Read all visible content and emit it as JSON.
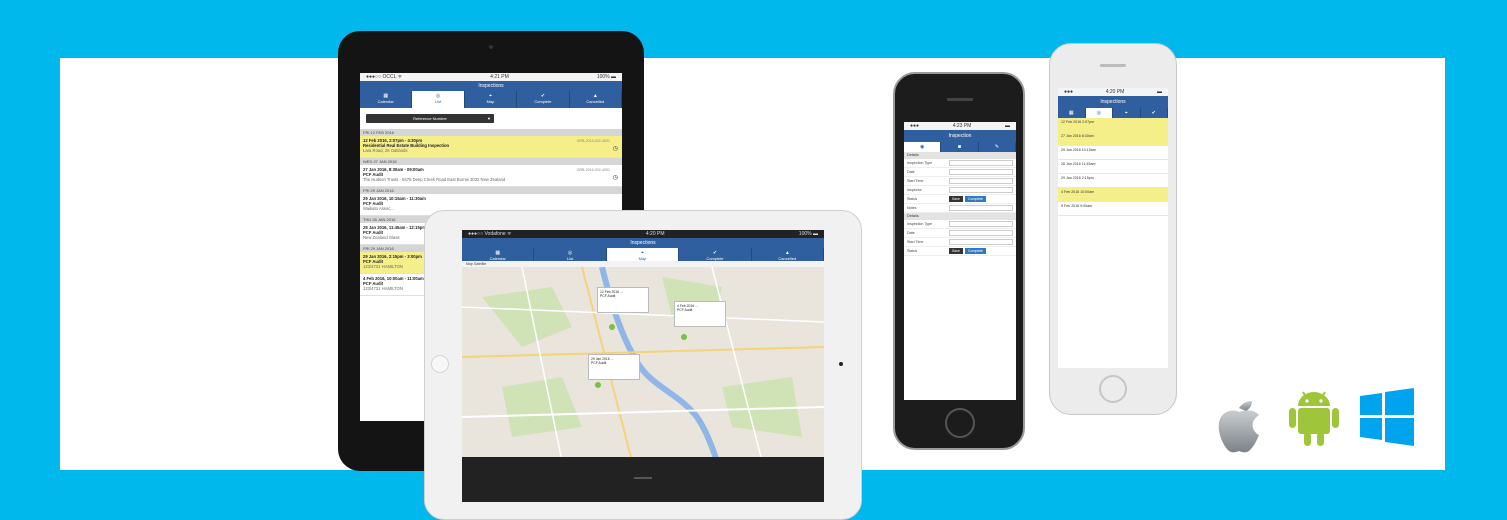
{
  "tablet_list": {
    "status_left": "●●●○○ OCCL ᯤ",
    "status_time": "4:21 PM",
    "status_right": "100% ▬",
    "title": "Inspections",
    "tabs": [
      "Calendar",
      "List",
      "Map",
      "Complete",
      "Cancelled"
    ],
    "filter_label": "Reference Number",
    "groups": [
      {
        "date": "FRI 12 FEB 2016",
        "time": "12 Feb 2016, 2:07pm - 4:30pm",
        "title": "Residential Real Estate Building Inspection",
        "addr": "Lara Road, 26 Oatlands",
        "ref": "ORB-2016-002-4001"
      },
      {
        "date": "WED 27 JAN 2016",
        "time": "27 Jan 2016, 8:30am - 09:00am",
        "title": "PCF Audit",
        "addr": "The Hudson Trusts - 5476 Deep Creek Road East Burnie 3032 New Zealand",
        "ref": "ORB-2016-002-4001"
      },
      {
        "date": "FRI 29 JAN 2016",
        "time": "29 Jan 2016, 10:15am - 11:30am",
        "title": "PCF Audit",
        "addr": "Waikato Assoc...",
        "ref": ""
      },
      {
        "date": "THU 28 JAN 2016",
        "time": "28 Jan 2016, 11:45am - 12:15pm",
        "title": "PCF Audit",
        "addr": "New Zealand Glass",
        "ref": ""
      },
      {
        "date": "FRI 29 JAN 2016",
        "time": "29 Jan 2016, 2:15pm - 3:00pm",
        "title": "PCF Audit",
        "addr": "123/4731 HAMILTON",
        "ref": ""
      },
      {
        "date": "",
        "time": "4 Feb 2016, 10:00am - 11:00am",
        "title": "PCF Audit",
        "addr": "123/4731 HAMILTON",
        "ref": ""
      }
    ]
  },
  "tablet_map": {
    "status_left": "●●●○○ Vodafone ᯤ",
    "status_time": "4:20 PM",
    "status_right": "100% ▬",
    "title": "Inspections",
    "tabs": [
      "Calendar",
      "List",
      "Map",
      "Complete",
      "Cancelled"
    ],
    "toolbar": "Map  Satellite",
    "popups": [
      {
        "title": "12 Feb 2016 ...",
        "line": "PCF Audit"
      },
      {
        "title": "4 Feb 2016 ...",
        "line": "PCF Audit"
      },
      {
        "title": "29 Jan 2016 ...",
        "line": "PCF Audit"
      }
    ]
  },
  "phone_form": {
    "status_time": "4:23 PM",
    "title": "Inspection",
    "rows": [
      "Inspection Type",
      "Date",
      "Start Time",
      "Inspector",
      "Status",
      "Notes"
    ],
    "buttons": [
      "Save",
      "Complete"
    ],
    "section": "Details"
  },
  "phone_list": {
    "status_time": "4:20 PM",
    "title": "Inspections",
    "rows": [
      {
        "text": "12 Feb 2016 2:07pm",
        "hl": true
      },
      {
        "text": "27 Jan 2016 8:30am",
        "hl": true
      },
      {
        "text": "29 Jan 2016 10:15am",
        "hl": false
      },
      {
        "text": "28 Jan 2016 11:45am",
        "hl": false
      },
      {
        "text": "29 Jan 2016 2:15pm",
        "hl": false
      },
      {
        "text": "4 Feb 2016 10:00am",
        "hl": true
      },
      {
        "text": "5 Feb 2016 9:00am",
        "hl": false
      }
    ]
  },
  "platforms": {
    "apple": "apple-icon",
    "android": "android-icon",
    "windows": "windows-icon",
    "colors": {
      "apple": "#9aa0a6",
      "android": "#9fc63b",
      "windows": "#00a3ee"
    }
  },
  "theme": {
    "background": "#00b8ec",
    "app_blue": "#2f5f9e",
    "highlight": "#f5ef8a"
  }
}
